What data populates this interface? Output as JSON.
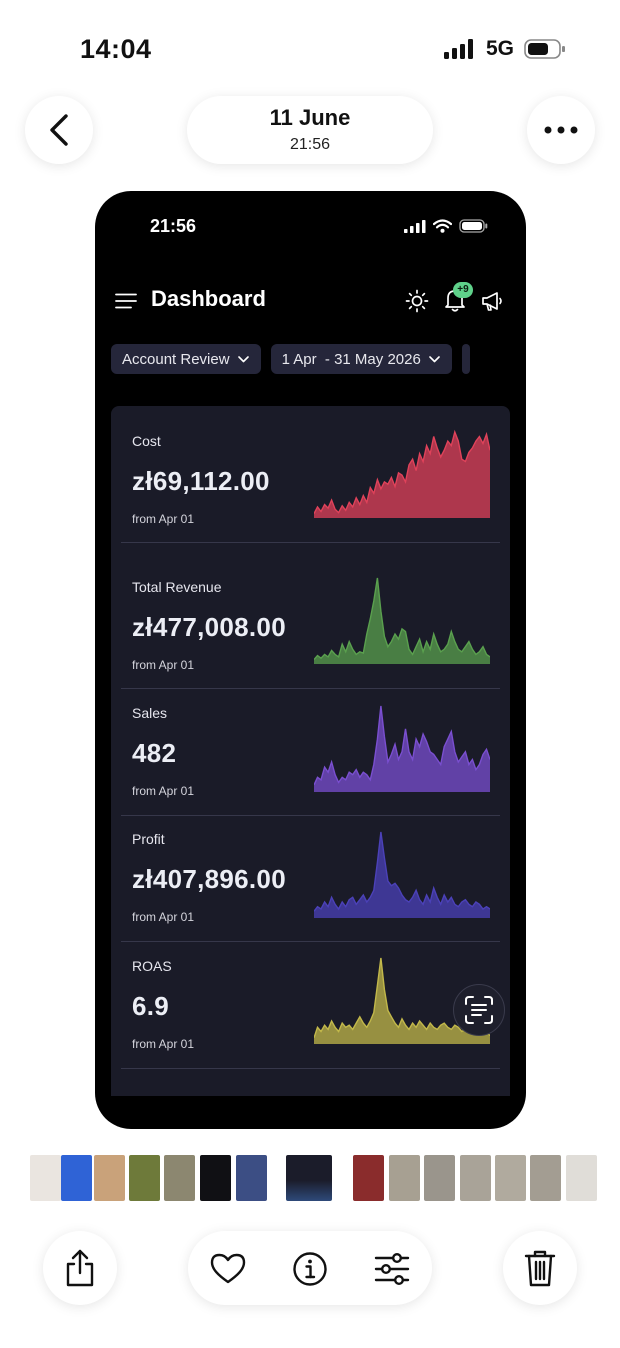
{
  "status_bar": {
    "time": "14:04",
    "network": "5G"
  },
  "header": {
    "date": "11 June",
    "time": "21:56"
  },
  "phone": {
    "status_time": "21:56",
    "app_title": "Dashboard",
    "notification_badge": "+9",
    "filters": [
      {
        "label": "Account Review"
      },
      {
        "label": "1 Apr  - 31 May 2026"
      }
    ],
    "metrics": [
      {
        "label": "Cost",
        "value": "zł69,112.00",
        "from": "from Apr 01",
        "color": "#e0425a",
        "spark": [
          2,
          8,
          4,
          10,
          7,
          14,
          6,
          3,
          9,
          5,
          12,
          8,
          16,
          10,
          18,
          12,
          25,
          20,
          32,
          24,
          30,
          28,
          34,
          26,
          38,
          36,
          30,
          45,
          50,
          40,
          55,
          48,
          62,
          55,
          70,
          60,
          52,
          58,
          66,
          62,
          74,
          66,
          50,
          48,
          56,
          60,
          66,
          70,
          64,
          72,
          58
        ]
      },
      {
        "label": "Total Revenue",
        "value": "zł477,008.00",
        "from": "from Apr 01",
        "color": "#5aa04e",
        "spark": [
          2,
          5,
          3,
          6,
          4,
          9,
          6,
          4,
          14,
          8,
          16,
          10,
          6,
          8,
          7,
          22,
          34,
          48,
          66,
          40,
          20,
          12,
          16,
          22,
          18,
          26,
          24,
          10,
          6,
          12,
          18,
          8,
          16,
          10,
          22,
          14,
          8,
          10,
          14,
          24,
          16,
          10,
          8,
          12,
          16,
          10,
          6,
          8,
          12,
          6,
          4
        ]
      },
      {
        "label": "Sales",
        "value": "482",
        "from": "from Apr 01",
        "color": "#7a4fd0",
        "spark": [
          4,
          10,
          8,
          18,
          14,
          22,
          12,
          6,
          10,
          8,
          14,
          12,
          16,
          10,
          14,
          12,
          8,
          20,
          40,
          66,
          42,
          22,
          28,
          36,
          24,
          30,
          48,
          30,
          24,
          40,
          34,
          44,
          38,
          30,
          28,
          24,
          20,
          34,
          40,
          46,
          30,
          22,
          26,
          30,
          20,
          24,
          16,
          20,
          28,
          32,
          24
        ]
      },
      {
        "label": "Profit",
        "value": "zł407,896.00",
        "from": "from Apr 01",
        "color": "#4b41b8",
        "spark": [
          4,
          8,
          6,
          12,
          8,
          16,
          10,
          6,
          12,
          8,
          14,
          16,
          10,
          14,
          18,
          12,
          16,
          22,
          46,
          72,
          50,
          30,
          26,
          28,
          24,
          18,
          14,
          12,
          16,
          22,
          14,
          10,
          18,
          12,
          24,
          16,
          10,
          18,
          12,
          16,
          10,
          8,
          12,
          14,
          10,
          8,
          12,
          10,
          6,
          8,
          6
        ]
      },
      {
        "label": "ROAS",
        "value": "6.9",
        "from": "from Apr 01",
        "color": "#c2b84a",
        "spark": [
          4,
          14,
          10,
          16,
          12,
          20,
          14,
          10,
          18,
          14,
          16,
          12,
          18,
          24,
          18,
          14,
          20,
          28,
          54,
          80,
          50,
          30,
          24,
          18,
          14,
          22,
          16,
          12,
          18,
          14,
          20,
          16,
          12,
          18,
          14,
          12,
          16,
          18,
          14,
          12,
          16,
          14,
          10,
          12,
          14,
          10,
          12,
          10,
          8,
          10,
          6
        ]
      }
    ]
  },
  "thumbnail_colors": [
    "#d8d0c6",
    "#2f63d6",
    "#c9a27a",
    "#6e7a3a",
    "#8c8770",
    "#101014",
    "#3c4e84",
    "#111116",
    "#8a2c2c",
    "#a7a092",
    "#9a958c",
    "#a9a398",
    "#b0aa9e",
    "#a39d92",
    "#c6c1b8"
  ],
  "toolbar": {
    "buttons": [
      "share-button",
      "favorite-button",
      "info-button",
      "adjust-button",
      "delete-button"
    ]
  }
}
